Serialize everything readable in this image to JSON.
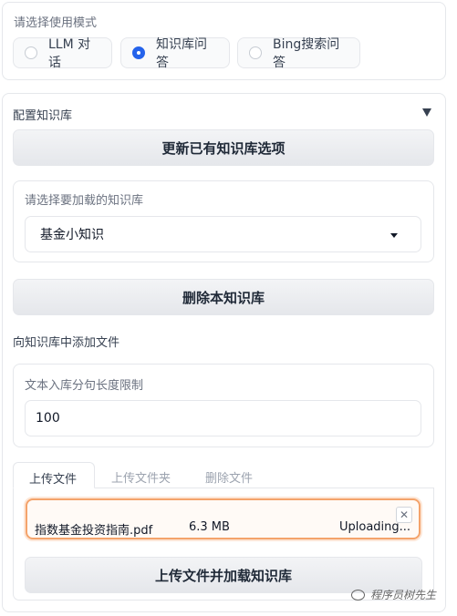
{
  "mode": {
    "title": "请选择使用模式",
    "options": [
      {
        "label": "LLM 对话",
        "selected": false
      },
      {
        "label": "知识库问答",
        "selected": true
      },
      {
        "label": "Bing搜索问答",
        "selected": false
      }
    ]
  },
  "kb_config": {
    "title": "配置知识库",
    "collapse_icon": "triangle-down-icon",
    "refresh_label": "更新已有知识库选项",
    "select_title": "请选择要加载的知识库",
    "select_value": "基金小知识",
    "delete_label": "删除本知识库",
    "add_files_title": "向知识库中添加文件",
    "chunk_title": "文本入库分句长度限制",
    "chunk_value": "100",
    "tabs": [
      "上传文件",
      "上传文件夹",
      "删除文件"
    ],
    "active_tab": 0,
    "file": {
      "name": "指数基金投资指南.pdf",
      "size": "6.3 MB",
      "status": "Uploading..."
    },
    "upload_label": "上传文件并加载知识库"
  },
  "watermark": "程序员树先生",
  "colors": {
    "accent": "#2563eb",
    "upload_border": "#f4a36b"
  }
}
